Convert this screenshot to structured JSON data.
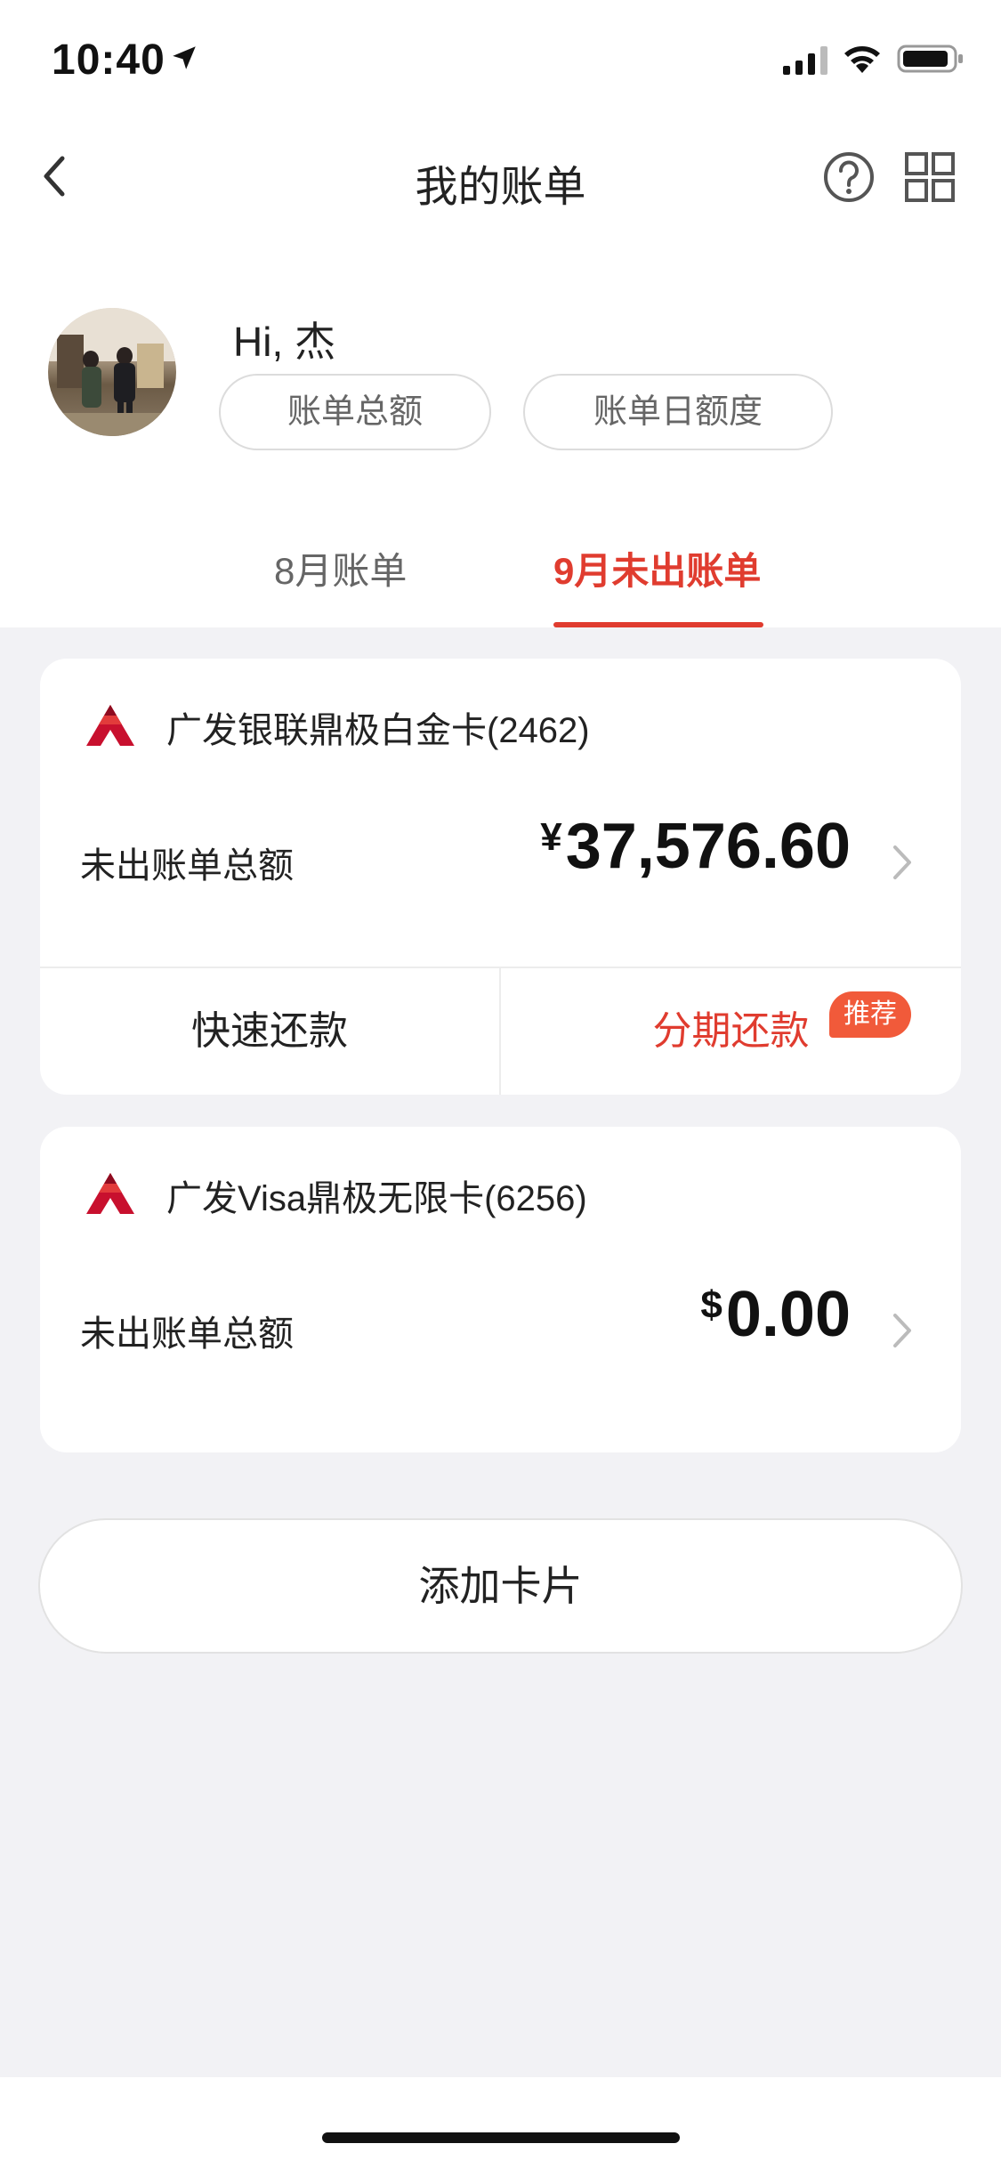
{
  "status_bar": {
    "time": "10:40"
  },
  "nav": {
    "title": "我的账单"
  },
  "profile": {
    "greeting": "Hi, 杰",
    "buttons": {
      "total": "账单总额",
      "daily_limit": "账单日额度"
    }
  },
  "tabs": [
    {
      "label": "8月账单",
      "active": false
    },
    {
      "label": "9月未出账单",
      "active": true
    }
  ],
  "cards": [
    {
      "name": "广发银联鼎极白金卡(2462)",
      "label": "未出账单总额",
      "currency": "¥",
      "amount": "37,576.60",
      "actions": {
        "quick_repay": "快速还款",
        "installment": "分期还款",
        "badge": "推荐"
      }
    },
    {
      "name": "广发Visa鼎极无限卡(6256)",
      "label": "未出账单总额",
      "currency": "$",
      "amount": "0.00"
    }
  ],
  "add_card_label": "添加卡片",
  "colors": {
    "accent": "#e03c2f",
    "badge": "#f15a3a",
    "background": "#f2f2f5"
  },
  "icons": [
    "location-arrow-icon",
    "signal-icon",
    "wifi-icon",
    "battery-icon",
    "back-icon",
    "help-icon",
    "grid-icon",
    "bank-logo-icon",
    "chevron-right-icon"
  ]
}
